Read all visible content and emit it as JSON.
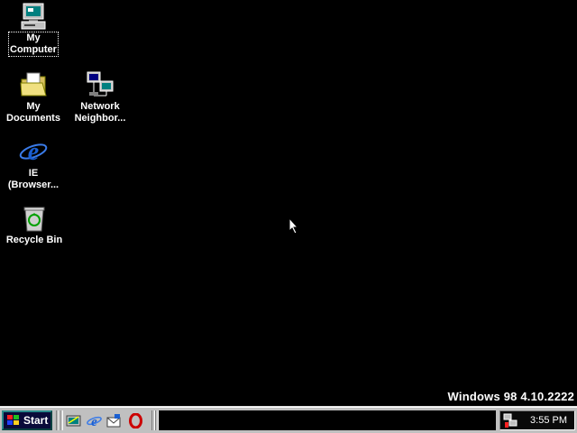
{
  "desktop": {
    "icons": [
      {
        "id": "my-computer",
        "label": "My\nComputer",
        "icon": "my-computer-icon"
      },
      {
        "id": "my-documents",
        "label": "My\nDocuments",
        "icon": "folder-documents-icon"
      },
      {
        "id": "network",
        "label": "Network\nNeighbor...",
        "icon": "network-neighborhood-icon"
      },
      {
        "id": "ie",
        "label": "IE\n(Browser...",
        "icon": "internet-explorer-icon"
      },
      {
        "id": "recycle",
        "label": "Recycle Bin",
        "icon": "recycle-bin-icon"
      }
    ],
    "version_text": "Windows 98 4.10.2222"
  },
  "taskbar": {
    "start_label": "Start",
    "quick_launch": [
      {
        "name": "show-desktop-icon"
      },
      {
        "name": "internet-explorer-icon"
      },
      {
        "name": "outlook-express-icon"
      },
      {
        "name": "opera-icon"
      }
    ],
    "clock": "3:55 PM"
  },
  "colors": {
    "desktop_bg": "#000000",
    "taskbar_bg": "#c0c0c0",
    "start_bg": "#0a0a3a",
    "ie_blue": "#1a5fd1",
    "opera_red": "#cc0000"
  }
}
